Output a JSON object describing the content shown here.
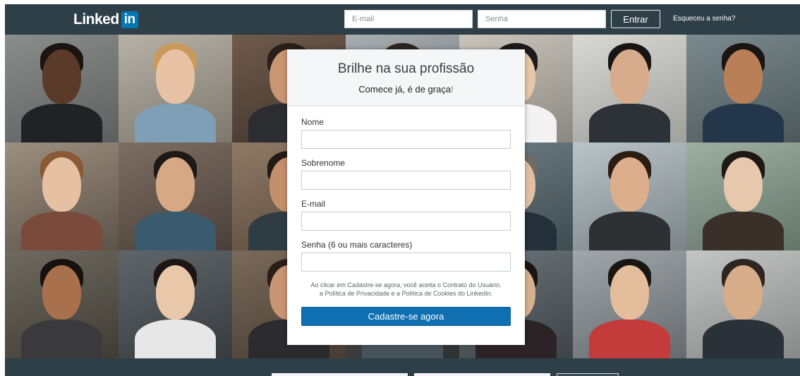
{
  "brand": {
    "logo_text": "Linked",
    "logo_badge": "in",
    "logo_color": "#0077b5"
  },
  "header": {
    "email_placeholder": "E-mail",
    "password_placeholder": "Senha",
    "login_button": "Entrar",
    "forgot_link": "Esqueceu a senha?"
  },
  "signup": {
    "title": "Brilhe na sua profissão",
    "subtitle": "Comece já, é de graça",
    "subtitle_mark": "!",
    "fields": [
      {
        "label": "Nome",
        "value": ""
      },
      {
        "label": "Sobrenome",
        "value": ""
      },
      {
        "label": "E-mail",
        "value": ""
      },
      {
        "label": "Senha (6 ou mais caracteres)",
        "value": ""
      }
    ],
    "terms": "Ao clicar em Cadastre-se agora, você aceita o Contrato do Usuário, a Política de Privacidade e a Política de Cookies do LinkedIn.",
    "submit_button": "Cadastre-se agora",
    "button_color": "#0f6fb1"
  },
  "colors": {
    "header_bg": "#2f3f48",
    "accent": "#5aa12d"
  }
}
